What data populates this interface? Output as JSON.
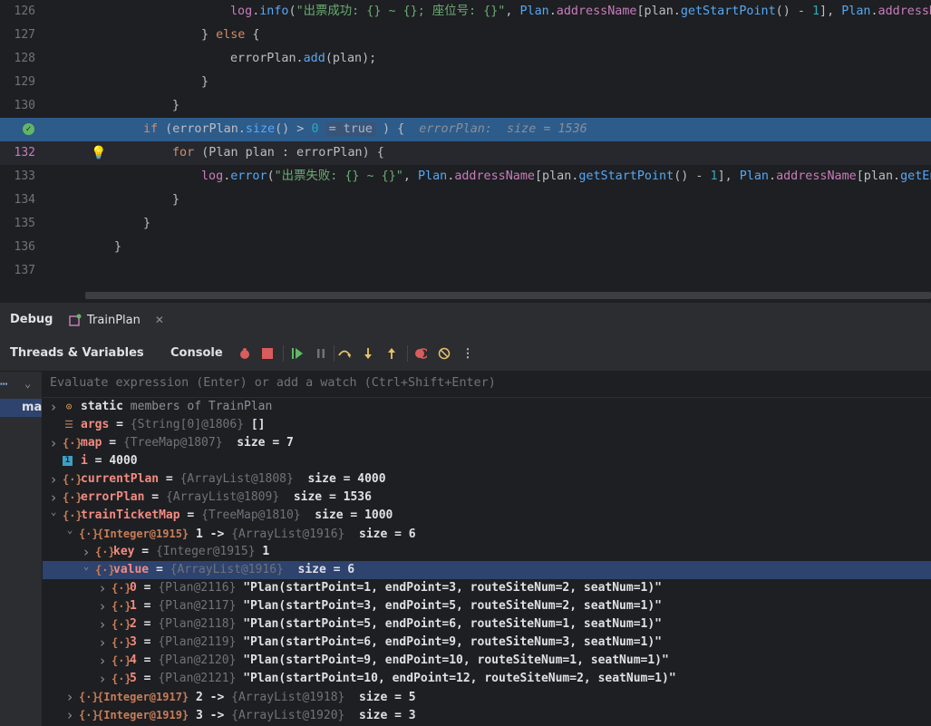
{
  "editor": {
    "lines": [
      {
        "n": "126",
        "indent": 7,
        "tokens": [
          [
            "fld",
            "log"
          ],
          [
            "cls",
            "."
          ],
          [
            "fn",
            "info"
          ],
          [
            "cls",
            "("
          ],
          [
            "str",
            "\"出票成功: {} ~ {}; 座位号: {}\""
          ],
          [
            "cls",
            ", "
          ],
          [
            "fn",
            "Plan"
          ],
          [
            "cls",
            "."
          ],
          [
            "fld",
            "addressName"
          ],
          [
            "cls",
            "[plan."
          ],
          [
            "fn",
            "getStartPoint"
          ],
          [
            "cls",
            "() - "
          ],
          [
            "num",
            "1"
          ],
          [
            "cls",
            "], "
          ],
          [
            "fn",
            "Plan"
          ],
          [
            "cls",
            "."
          ],
          [
            "fld",
            "addressName"
          ]
        ]
      },
      {
        "n": "127",
        "indent": 6,
        "tokens": [
          [
            "cls",
            "} "
          ],
          [
            "kw",
            "else"
          ],
          [
            "cls",
            " {"
          ]
        ]
      },
      {
        "n": "128",
        "indent": 7,
        "tokens": [
          [
            "cls",
            "errorPlan."
          ],
          [
            "fn",
            "add"
          ],
          [
            "cls",
            "(plan);"
          ]
        ]
      },
      {
        "n": "129",
        "indent": 6,
        "tokens": [
          [
            "cls",
            "}"
          ]
        ]
      },
      {
        "n": "130",
        "indent": 5,
        "tokens": [
          [
            "cls",
            "}"
          ]
        ]
      },
      {
        "n": "131",
        "indent": 4,
        "exec": true,
        "tokens": [
          [
            "kw",
            "if"
          ],
          [
            "cls",
            " (errorPlan."
          ],
          [
            "fn",
            "size"
          ],
          [
            "cls",
            "() > "
          ],
          [
            "num",
            "0"
          ]
        ]
      },
      {
        "n": "132",
        "indent": 5,
        "cur": true,
        "tokens": [
          [
            "kw",
            "for"
          ],
          [
            "cls",
            " (Plan plan : errorPlan) {"
          ]
        ]
      },
      {
        "n": "133",
        "indent": 6,
        "tokens": [
          [
            "fld",
            "log"
          ],
          [
            "cls",
            "."
          ],
          [
            "fn",
            "error"
          ],
          [
            "cls",
            "("
          ],
          [
            "str",
            "\"出票失败: {} ~ {}\""
          ],
          [
            "cls",
            ", "
          ],
          [
            "fn",
            "Plan"
          ],
          [
            "cls",
            "."
          ],
          [
            "fld",
            "addressName"
          ],
          [
            "cls",
            "[plan."
          ],
          [
            "fn",
            "getStartPoint"
          ],
          [
            "cls",
            "() - "
          ],
          [
            "num",
            "1"
          ],
          [
            "cls",
            "], "
          ],
          [
            "fn",
            "Plan"
          ],
          [
            "cls",
            "."
          ],
          [
            "fld",
            "addressName"
          ],
          [
            "cls",
            "[plan."
          ],
          [
            "fn",
            "getEn"
          ]
        ]
      },
      {
        "n": "134",
        "indent": 5,
        "tokens": [
          [
            "cls",
            "}"
          ]
        ]
      },
      {
        "n": "135",
        "indent": 4,
        "tokens": [
          [
            "cls",
            "}"
          ]
        ]
      },
      {
        "n": "136",
        "indent": 3,
        "tokens": [
          [
            "cls",
            "}"
          ]
        ]
      },
      {
        "n": "137",
        "indent": 0,
        "tokens": []
      }
    ],
    "exec_true": "= true",
    "exec_tail": " {",
    "exec_hint": "errorPlan:  size = 1536"
  },
  "debug": {
    "tab_debug": "Debug",
    "tab_config": "TrainPlan",
    "tab_threads": "Threads & Variables",
    "tab_console": "Console",
    "watch_placeholder": "Evaluate expression (Enter) or add a watch (Ctrl+Shift+Enter)",
    "side_thread": "mai"
  },
  "variables": [
    {
      "depth": 0,
      "arrow": ">",
      "icon": "static",
      "name": "static",
      "rest": " members of TrainPlan",
      "plain": true
    },
    {
      "depth": 0,
      "arrow": "",
      "icon": "args",
      "name": "args",
      "eq": " = ",
      "ref": "{String[0]@1806}",
      "val": " []"
    },
    {
      "depth": 0,
      "arrow": ">",
      "icon": "obj",
      "name": "map",
      "eq": " = ",
      "ref": "{TreeMap@1807}",
      "val": "  size = 7"
    },
    {
      "depth": 0,
      "arrow": "",
      "icon": "prim",
      "name": "i",
      "eq": " = ",
      "val": "4000"
    },
    {
      "depth": 0,
      "arrow": ">",
      "icon": "obj",
      "name": "currentPlan",
      "eq": " = ",
      "ref": "{ArrayList@1808}",
      "val": "  size = 4000"
    },
    {
      "depth": 0,
      "arrow": ">",
      "icon": "obj",
      "name": "errorPlan",
      "eq": " = ",
      "ref": "{ArrayList@1809}",
      "val": "  size = 1536"
    },
    {
      "depth": 0,
      "arrow": "v",
      "icon": "obj",
      "name": "trainTicketMap",
      "eq": " = ",
      "ref": "{TreeMap@1810}",
      "val": "  size = 1000"
    },
    {
      "depth": 1,
      "arrow": "v",
      "icon": "obj",
      "ref2": "{Integer@1915}",
      "val": " 1 -> ",
      "ref": "{ArrayList@1916}",
      "val2": "  size = 6"
    },
    {
      "depth": 2,
      "arrow": ">",
      "icon": "obj",
      "name": "key",
      "eq": " = ",
      "ref": "{Integer@1915}",
      "val": " 1"
    },
    {
      "depth": 2,
      "arrow": "v",
      "icon": "obj",
      "name": "value",
      "eq": " = ",
      "ref": "{ArrayList@1916}",
      "val": "  size = 6",
      "sel": true
    },
    {
      "depth": 3,
      "arrow": ">",
      "icon": "obj",
      "name": "0",
      "eq": " = ",
      "ref": "{Plan@2116}",
      "val": " \"Plan(startPoint=1, endPoint=3, routeSiteNum=2, seatNum=1)\""
    },
    {
      "depth": 3,
      "arrow": ">",
      "icon": "obj",
      "name": "1",
      "eq": " = ",
      "ref": "{Plan@2117}",
      "val": " \"Plan(startPoint=3, endPoint=5, routeSiteNum=2, seatNum=1)\""
    },
    {
      "depth": 3,
      "arrow": ">",
      "icon": "obj",
      "name": "2",
      "eq": " = ",
      "ref": "{Plan@2118}",
      "val": " \"Plan(startPoint=5, endPoint=6, routeSiteNum=1, seatNum=1)\""
    },
    {
      "depth": 3,
      "arrow": ">",
      "icon": "obj",
      "name": "3",
      "eq": " = ",
      "ref": "{Plan@2119}",
      "val": " \"Plan(startPoint=6, endPoint=9, routeSiteNum=3, seatNum=1)\""
    },
    {
      "depth": 3,
      "arrow": ">",
      "icon": "obj",
      "name": "4",
      "eq": " = ",
      "ref": "{Plan@2120}",
      "val": " \"Plan(startPoint=9, endPoint=10, routeSiteNum=1, seatNum=1)\""
    },
    {
      "depth": 3,
      "arrow": ">",
      "icon": "obj",
      "name": "5",
      "eq": " = ",
      "ref": "{Plan@2121}",
      "val": " \"Plan(startPoint=10, endPoint=12, routeSiteNum=2, seatNum=1)\""
    },
    {
      "depth": 1,
      "arrow": ">",
      "icon": "obj",
      "ref2": "{Integer@1917}",
      "val": " 2 -> ",
      "ref": "{ArrayList@1918}",
      "val2": "  size = 5"
    },
    {
      "depth": 1,
      "arrow": ">",
      "icon": "obj",
      "ref2": "{Integer@1919}",
      "val": " 3 -> ",
      "ref": "{ArrayList@1920}",
      "val2": "  size = 3"
    }
  ]
}
